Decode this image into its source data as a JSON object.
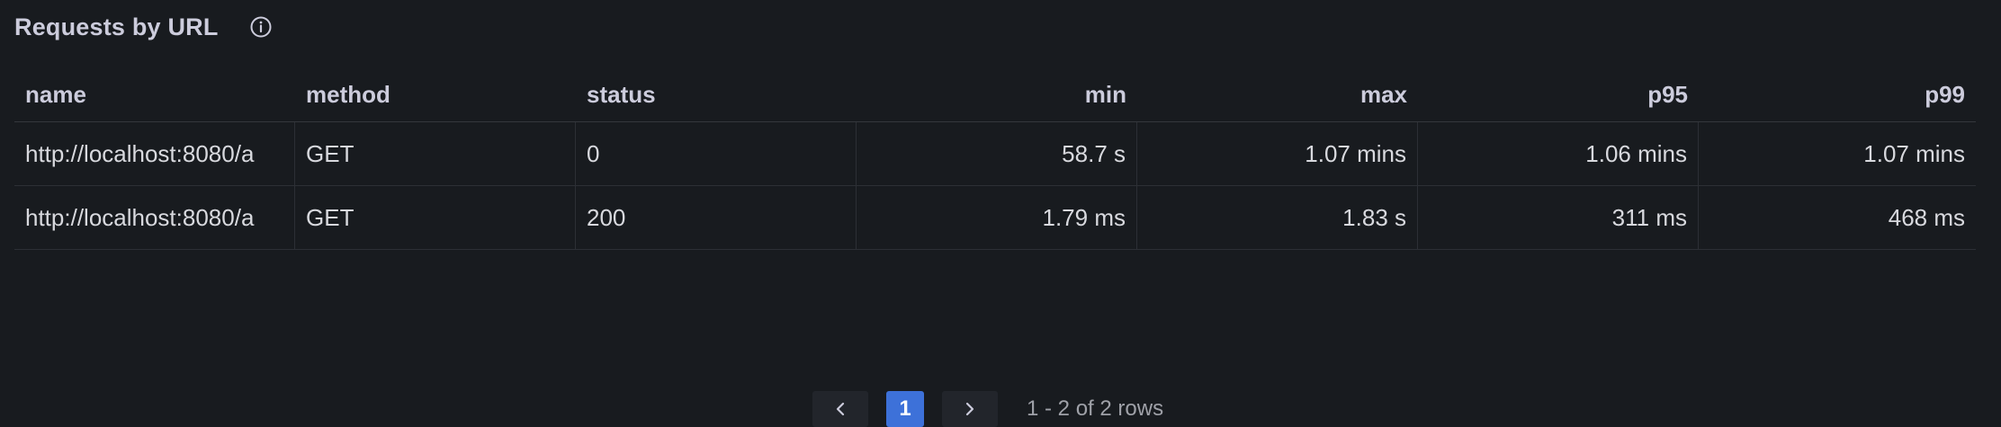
{
  "panel": {
    "title": "Requests by URL",
    "info_icon": "info-circle-icon"
  },
  "table": {
    "columns": [
      "name",
      "method",
      "status",
      "min",
      "max",
      "p95",
      "p99"
    ],
    "rows": [
      [
        "http://localhost:8080/a",
        "GET",
        "0",
        "58.7 s",
        "1.07 mins",
        "1.06 mins",
        "1.07 mins"
      ],
      [
        "http://localhost:8080/a",
        "GET",
        "200",
        "1.79 ms",
        "1.83 s",
        "311 ms",
        "468 ms"
      ]
    ]
  },
  "pagination": {
    "prev_icon": "chevron-left-icon",
    "next_icon": "chevron-right-icon",
    "current_page": "1",
    "summary": "1 - 2 of 2 rows"
  },
  "colors": {
    "background": "#181b1f",
    "accent": "#3d71d9",
    "text": "#d8d9de",
    "border": "#2c2f35"
  }
}
